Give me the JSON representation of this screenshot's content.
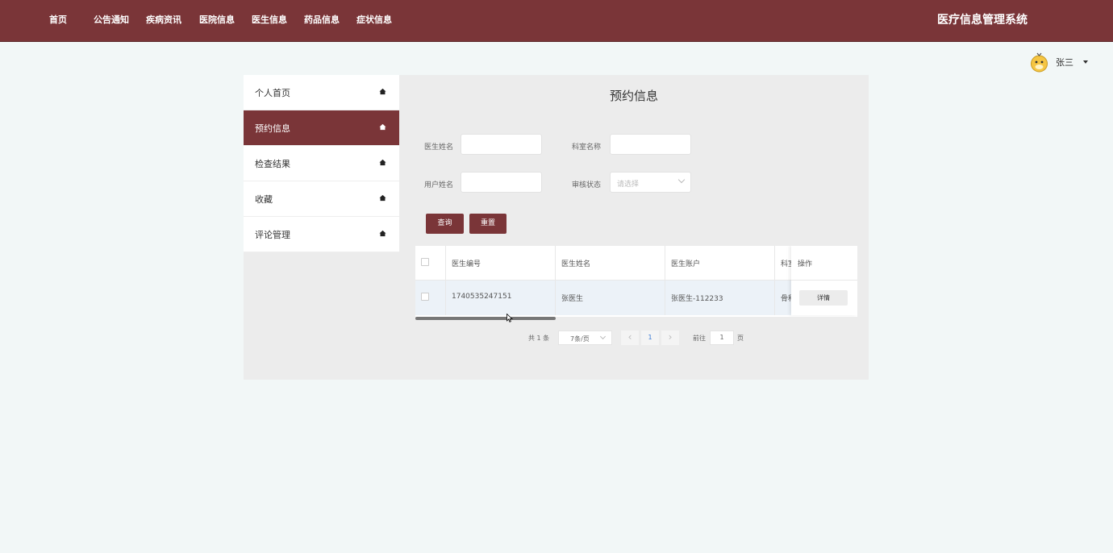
{
  "header": {
    "nav": [
      "首页",
      "公告通知",
      "疾病资讯",
      "医院信息",
      "医生信息",
      "药品信息",
      "症状信息"
    ],
    "system_title": "医疗信息管理系统"
  },
  "user": {
    "name": "张三"
  },
  "sidebar": {
    "items": [
      {
        "label": "个人首页"
      },
      {
        "label": "预约信息"
      },
      {
        "label": "检查结果"
      },
      {
        "label": "收藏"
      },
      {
        "label": "评论管理"
      }
    ]
  },
  "main": {
    "title": "预约信息",
    "form": {
      "doctor_name_label": "医生姓名",
      "dept_name_label": "科室名称",
      "user_name_label": "用户姓名",
      "review_status_label": "审核状态",
      "review_status_placeholder": "请选择"
    },
    "buttons": {
      "query": "查询",
      "reset": "重置"
    },
    "table": {
      "columns": [
        "医生编号",
        "医生姓名",
        "医生账户",
        "科室",
        "操作"
      ],
      "rows": [
        {
          "doctor_id": "1740535247151",
          "doctor_name": "张医生",
          "doctor_account": "张医生-112233",
          "dept": "骨科",
          "action": "详情"
        }
      ]
    },
    "pagination": {
      "total_text": "共 1 条",
      "page_size": "7条/页",
      "current_page": "1",
      "goto_label": "前往",
      "goto_value": "1",
      "page_suffix": "页"
    }
  },
  "colors": {
    "brand": "#7a3538",
    "background": "#f2f7f7",
    "panel": "#ececec"
  }
}
